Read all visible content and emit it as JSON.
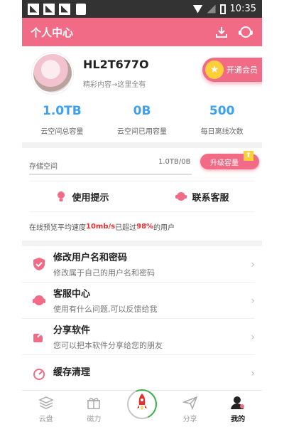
{
  "status": {
    "time": "10:35"
  },
  "header": {
    "title": "个人中心",
    "download_icon": "download-icon",
    "headset_icon": "support-headset-icon"
  },
  "profile": {
    "username": "HL2T677O",
    "subtitle": "精彩内容→这里全有",
    "vip_label": "开通会员"
  },
  "stats": [
    {
      "value": "1.0TB",
      "label": "云空间总容量"
    },
    {
      "value": "0B",
      "label": "云空间已用容量"
    },
    {
      "value": "500",
      "label": "每日离线次数"
    }
  ],
  "storage": {
    "label": "存储空间",
    "value": "1.0TB/0B",
    "used_fraction": 0.0,
    "upgrade_label": "升级容量"
  },
  "links": {
    "tips_label": "使用提示",
    "support_label": "联系客服"
  },
  "speed": {
    "prefix": "在线预览平均速度",
    "speed": "10mb/s",
    "middle": "已超过",
    "percent": "98%",
    "suffix": "的用户"
  },
  "menu": [
    {
      "title": "修改用户名和密码",
      "desc": "修改属于自己的用户名和密码"
    },
    {
      "title": "客服中心",
      "desc": "使用有什么问题,可以反馈给我"
    },
    {
      "title": "分享软件",
      "desc": "您可以把本软件分享给您的朋友"
    },
    {
      "title": "缓存清理",
      "desc": ""
    }
  ],
  "tabbar": {
    "cloud": "云盘",
    "magnet": "磁力",
    "share": "分享",
    "mine": "我的"
  },
  "colors": {
    "accent": "#f26b86",
    "blue": "#3ea0f0",
    "highlight": "#e53030"
  }
}
